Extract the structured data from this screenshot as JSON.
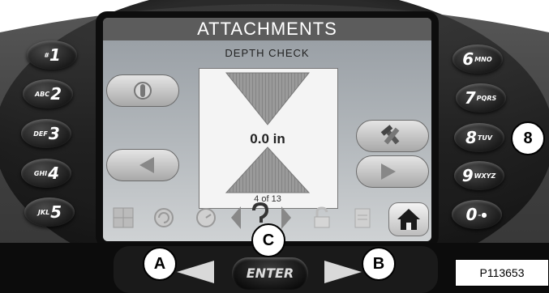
{
  "screen": {
    "title": "ATTACHMENTS",
    "subtitle": "DEPTH CHECK",
    "value": "0.0 in",
    "pager": "4 of 13"
  },
  "keypad_left": [
    {
      "prefix": "#",
      "digit": "1"
    },
    {
      "prefix": "ABC",
      "digit": "2"
    },
    {
      "prefix": "DEF",
      "digit": "3"
    },
    {
      "prefix": "GHI",
      "digit": "4"
    },
    {
      "prefix": "JKL",
      "digit": "5"
    }
  ],
  "keypad_right": [
    {
      "digit": "6",
      "suffix": "MNO"
    },
    {
      "digit": "7",
      "suffix": "PQRS"
    },
    {
      "digit": "8",
      "suffix": "TUV"
    },
    {
      "digit": "9",
      "suffix": "WXYZ"
    },
    {
      "digit": "0",
      "suffix": "–●"
    }
  ],
  "callouts": {
    "a": "A",
    "b": "B",
    "c": "C",
    "eight": "8"
  },
  "enter_label": "ENTER",
  "figure_label": "P113653"
}
